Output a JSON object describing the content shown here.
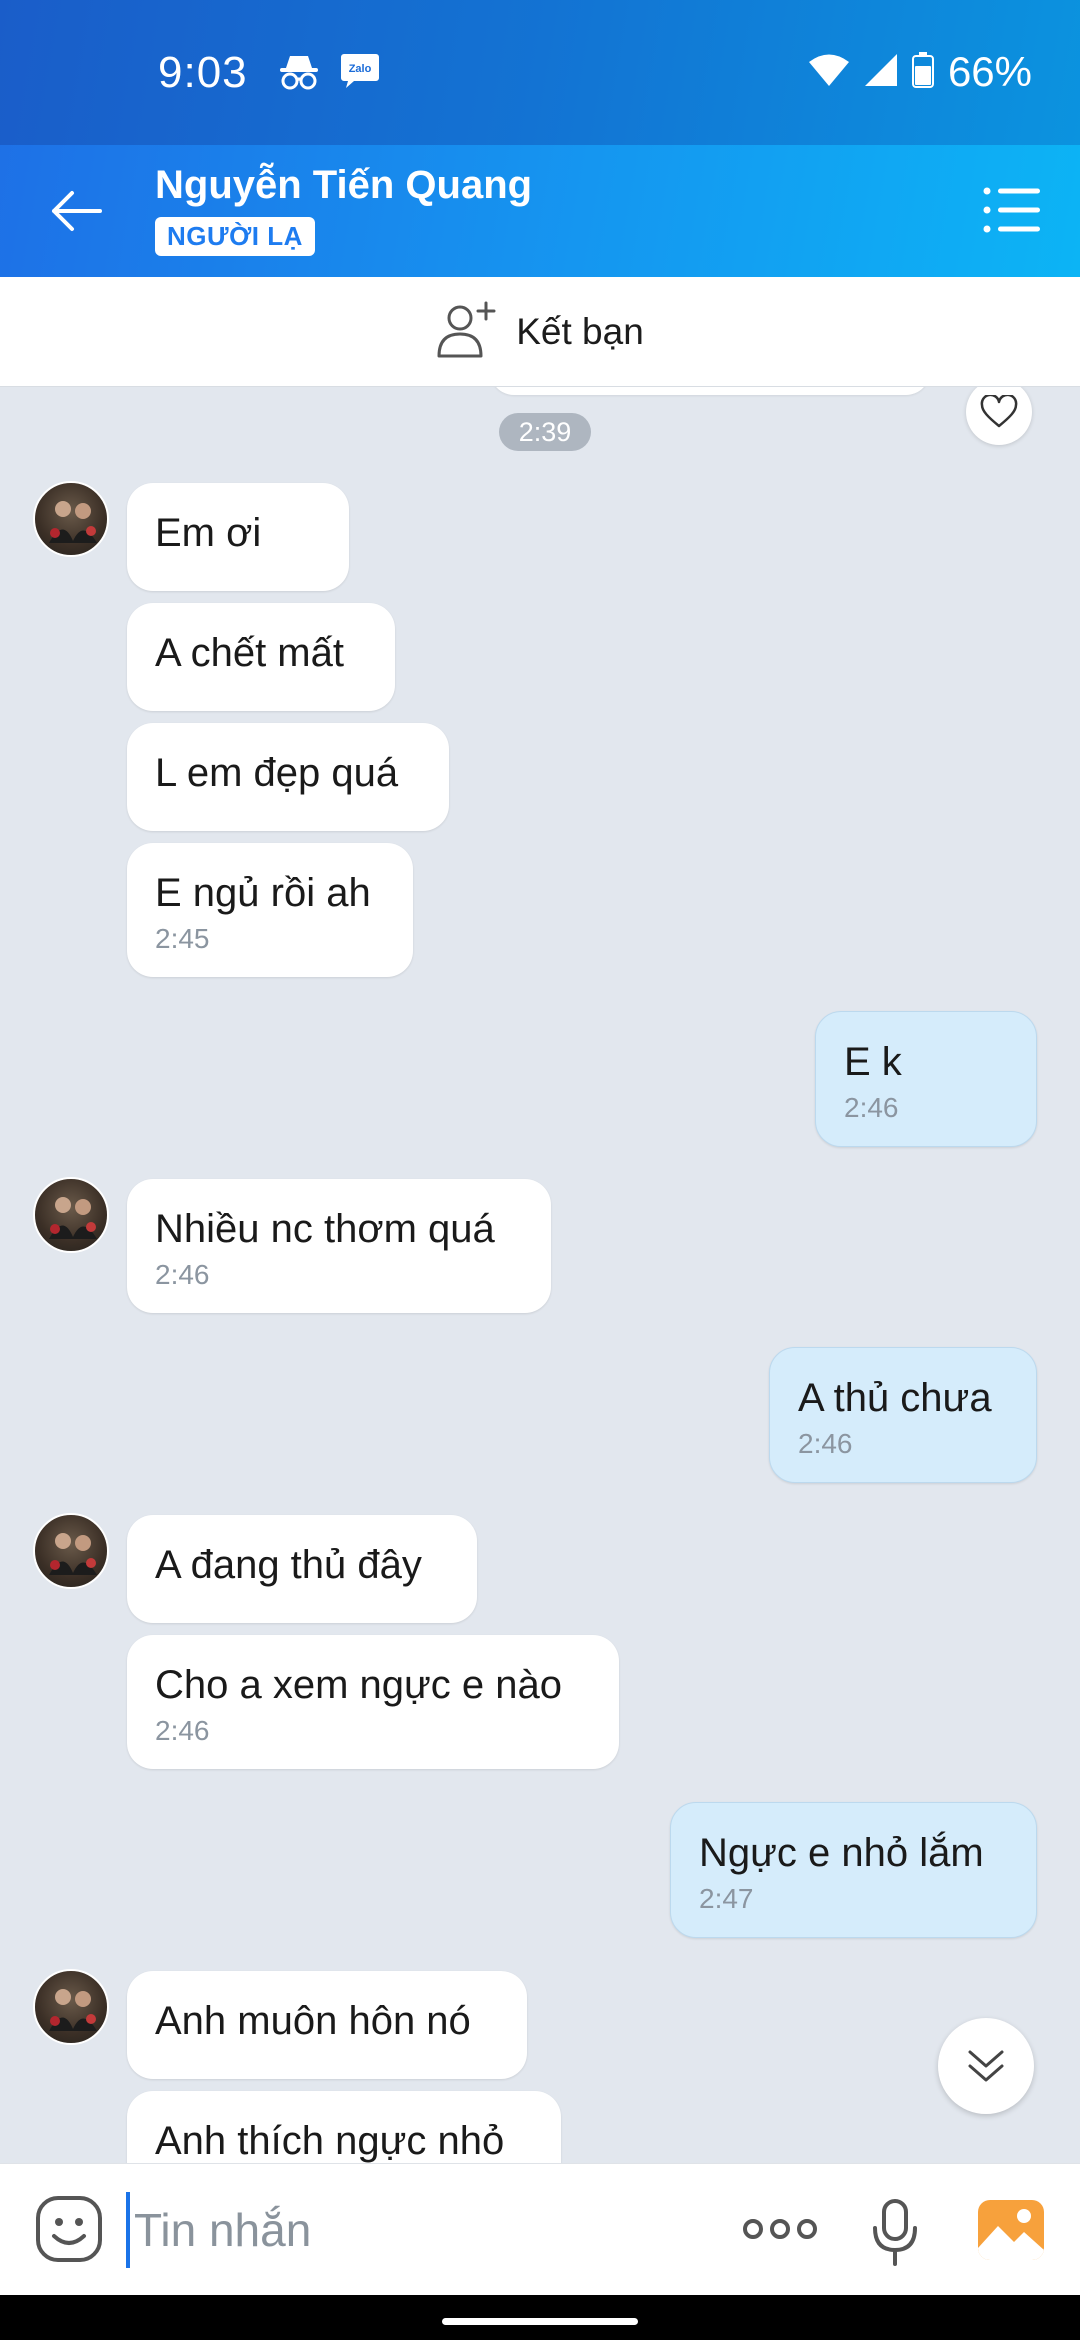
{
  "status_bar": {
    "time": "9:03",
    "battery": "66%",
    "icons": [
      "incognito-icon",
      "zalo-notification-icon",
      "wifi-icon",
      "signal-icon",
      "battery-icon"
    ],
    "zalo_badge": "Zalo"
  },
  "header": {
    "contact_name": "Nguyễn Tiến Quang",
    "badge": "NGƯỜI LẠ",
    "back_icon": "arrow-left-icon",
    "menu_icon": "list-menu-icon"
  },
  "friend_bar": {
    "label": "Kết bạn",
    "icon": "add-person-icon"
  },
  "chat": {
    "time_separator": "2:39",
    "groups": [
      {
        "sender": "in",
        "messages": [
          {
            "text": "Em ơi",
            "time": ""
          },
          {
            "text": "A chết mất",
            "time": ""
          },
          {
            "text": "L em đẹp quá",
            "time": ""
          },
          {
            "text": "E ngủ rồi ah",
            "time": "2:45"
          }
        ]
      },
      {
        "sender": "out",
        "messages": [
          {
            "text": "E k",
            "time": "2:46"
          }
        ]
      },
      {
        "sender": "in",
        "messages": [
          {
            "text": "Nhiều nc thơm quá",
            "time": "2:46"
          }
        ]
      },
      {
        "sender": "out",
        "messages": [
          {
            "text": "A thủ chưa",
            "time": "2:46"
          }
        ]
      },
      {
        "sender": "in",
        "messages": [
          {
            "text": "A đang thủ đây",
            "time": ""
          },
          {
            "text": "Cho a xem ngực e nào",
            "time": "2:46"
          }
        ]
      },
      {
        "sender": "out",
        "messages": [
          {
            "text": "Ngực e nhỏ lắm",
            "time": "2:47"
          }
        ]
      },
      {
        "sender": "in",
        "messages": [
          {
            "text": "Anh muôn hôn nó",
            "time": ""
          },
          {
            "text": "Anh thích ngực nhỏ",
            "time": ""
          }
        ]
      }
    ]
  },
  "input_bar": {
    "placeholder": "Tin nhắn",
    "icons": [
      "emoji-icon",
      "more-dots-icon",
      "microphone-icon",
      "image-icon"
    ]
  },
  "colors": {
    "header_start": "#1e6fe6",
    "header_end": "#0cb4f5",
    "chat_bg": "#e2e7ee",
    "outgoing_bubble": "#d5ecfb",
    "incoming_bubble": "#ffffff"
  }
}
